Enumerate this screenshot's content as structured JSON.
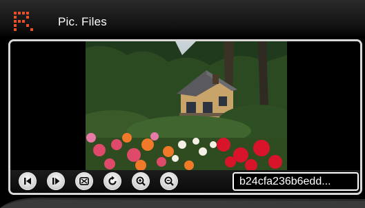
{
  "header": {
    "title": "Pic. Files",
    "logo_icon": "grid-logo-icon"
  },
  "viewer": {
    "image_description_icon": "photo-image"
  },
  "controls": {
    "buttons": [
      {
        "name": "previous-button",
        "icon": "skip-previous-icon"
      },
      {
        "name": "next-button",
        "icon": "skip-next-icon"
      },
      {
        "name": "slideshow-button",
        "icon": "slideshow-icon"
      },
      {
        "name": "rotate-button",
        "icon": "rotate-icon"
      },
      {
        "name": "zoom-in-button",
        "icon": "zoom-in-icon"
      },
      {
        "name": "zoom-out-button",
        "icon": "zoom-out-icon"
      }
    ],
    "filename": "b24cfa236b6edd..."
  },
  "colors": {
    "background": "#000000",
    "logo": "#e8502a",
    "frame_border": "#d8d8d8",
    "text": "#ffffff"
  }
}
